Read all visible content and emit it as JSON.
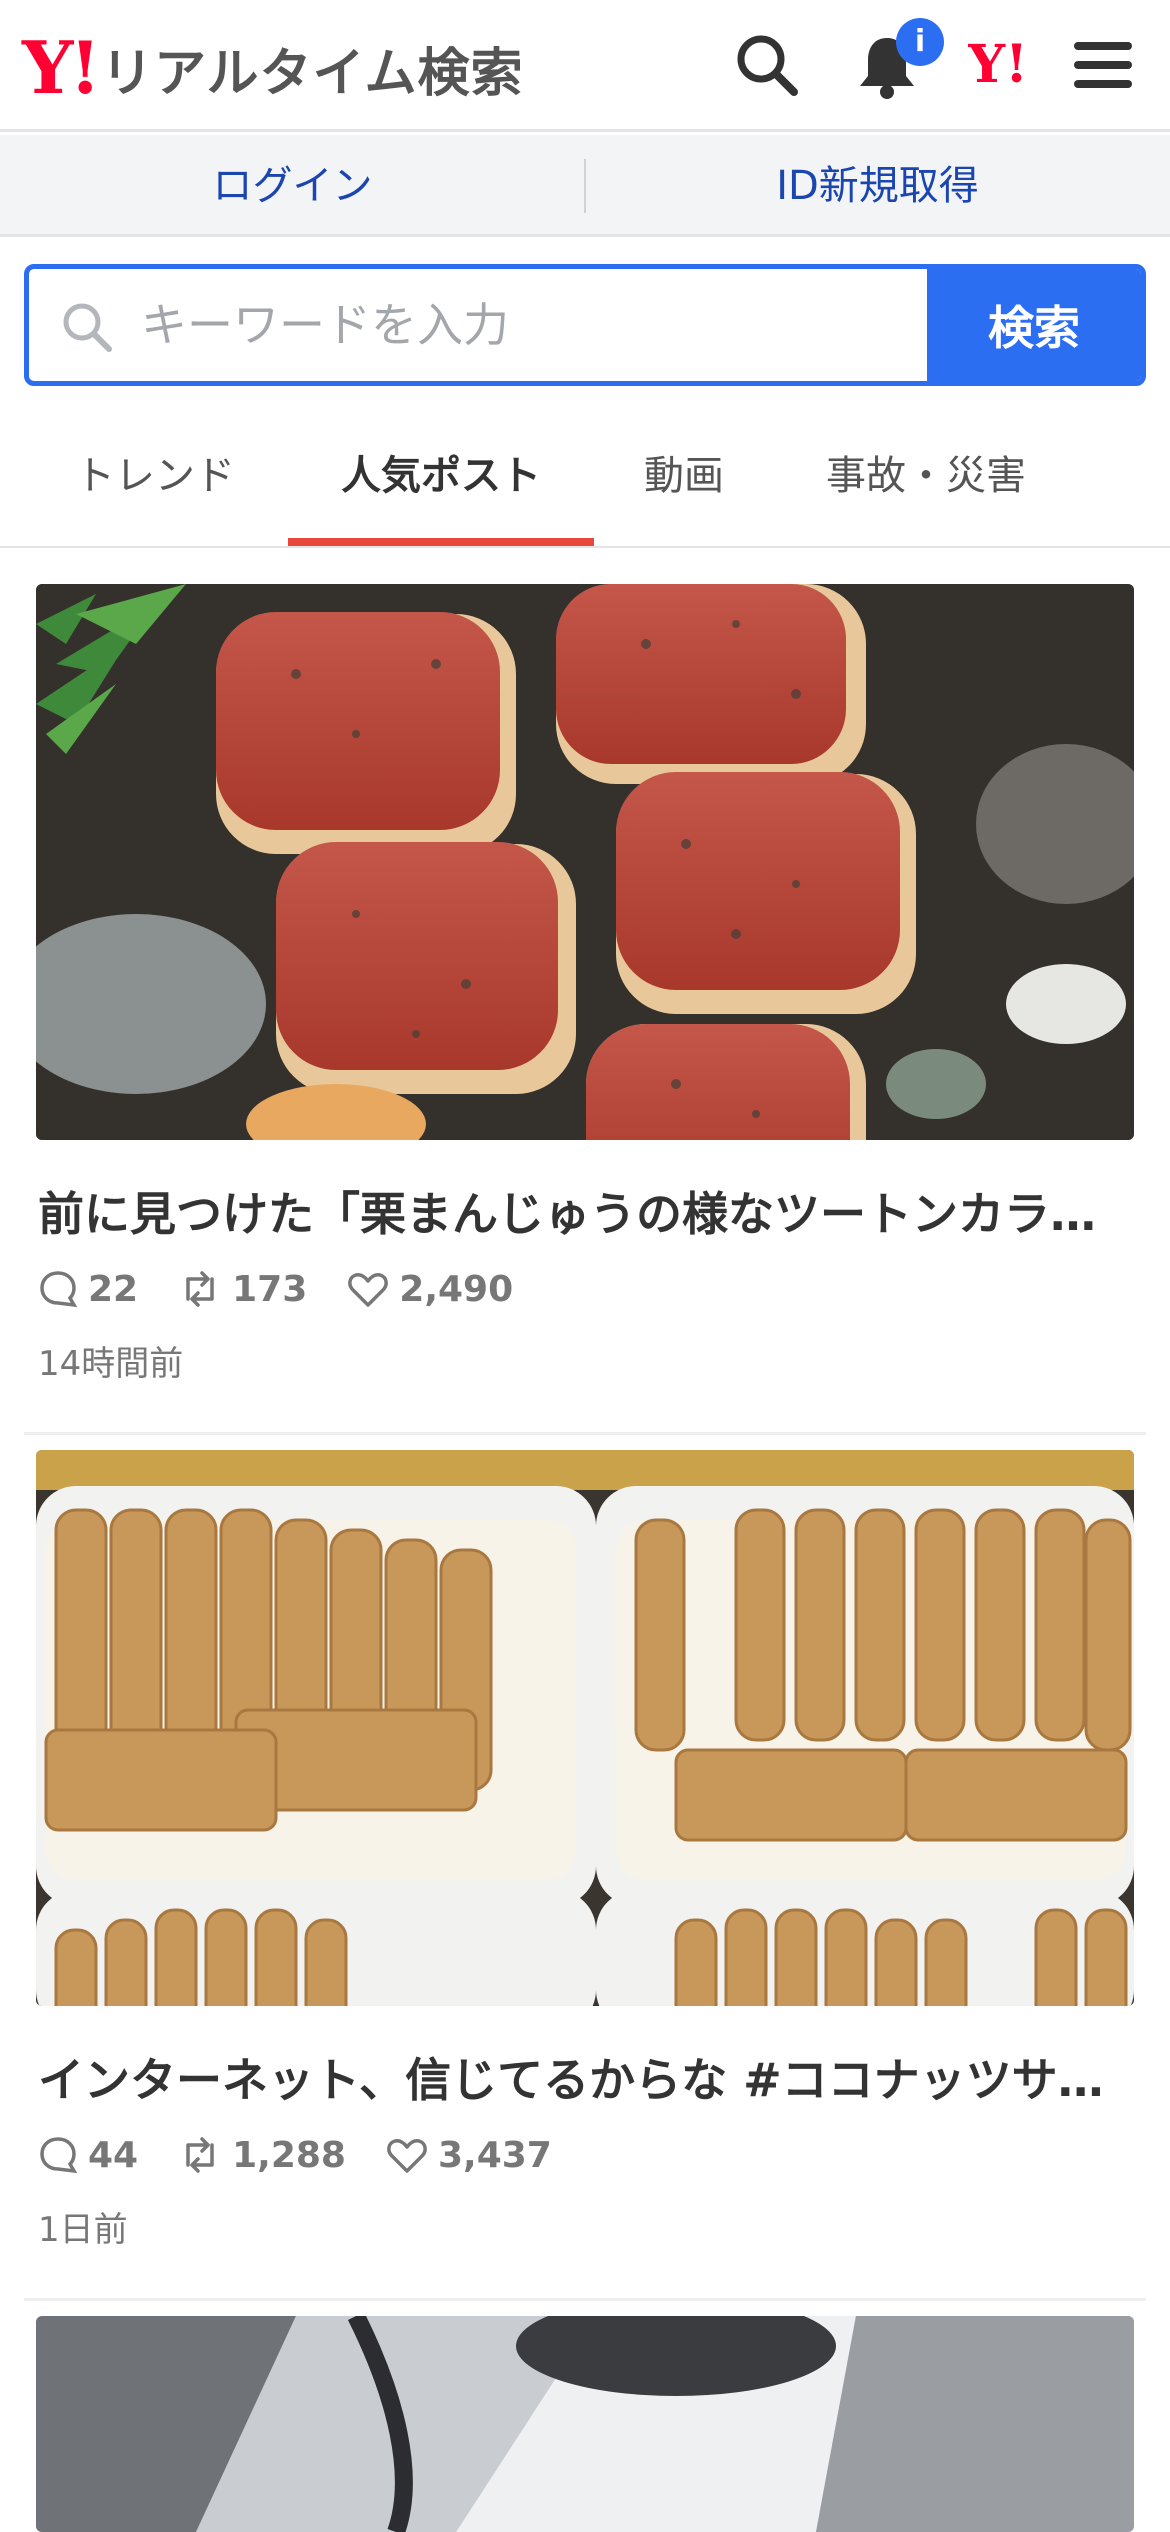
{
  "header": {
    "logo_y": "Y!",
    "logo_text": "リアルタイム検索",
    "notification_badge": "i",
    "icons": [
      "search-icon",
      "bell-icon",
      "yahoo-logo-icon",
      "menu-icon"
    ]
  },
  "login_bar": {
    "login_label": "ログイン",
    "register_label": "ID新規取得"
  },
  "search": {
    "placeholder": "キーワードを入力",
    "value": "",
    "button_label": "検索"
  },
  "tabs": [
    {
      "label": "トレンド",
      "active": false
    },
    {
      "label": "人気ポスト",
      "active": true
    },
    {
      "label": "動画",
      "active": false
    },
    {
      "label": "事故・災害",
      "active": false
    }
  ],
  "posts": [
    {
      "title": "前に見つけた「栗まんじゅうの様なツートンカラーの石」",
      "replies": "22",
      "reposts": "173",
      "likes": "2,490",
      "time": "14時間前"
    },
    {
      "title": "インターネット、信じてるからな #ココナッツサブレ",
      "replies": "44",
      "reposts": "1,288",
      "likes": "3,437",
      "time": "1日前"
    }
  ],
  "colors": {
    "accent_blue": "#2c6ef2",
    "brand_red": "#ff0033",
    "tab_underline": "#e8483c",
    "link_blue": "#1b46b0"
  }
}
